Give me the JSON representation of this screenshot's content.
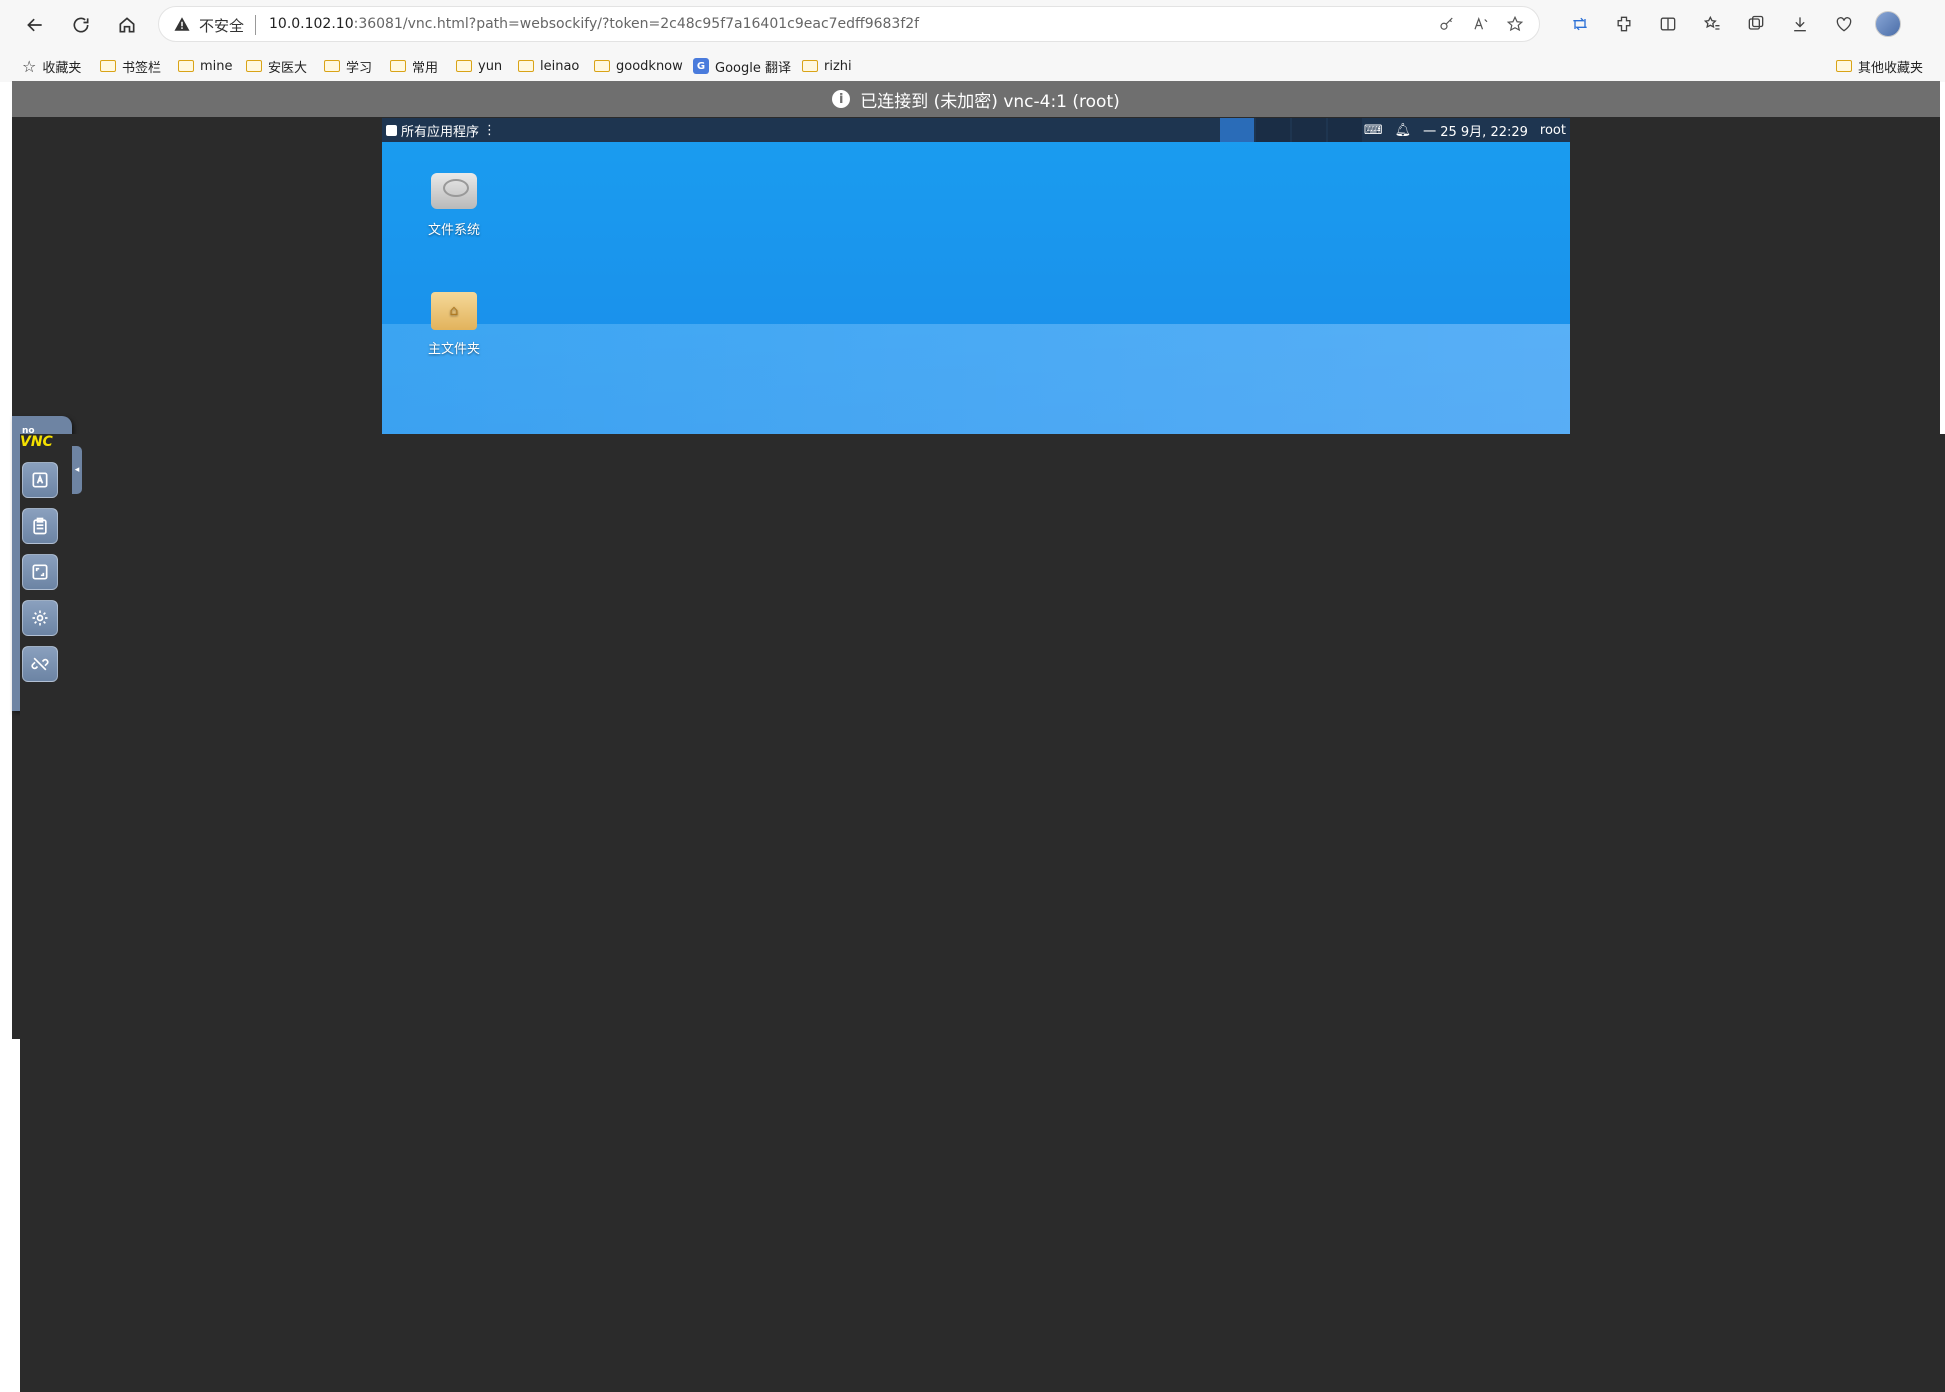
{
  "browser": {
    "insecure_label": "不安全",
    "url_host": "10.0.102.10",
    "url_rest": ":36081/vnc.html?path=websockify/?token=2c48c95f7a16401c9eac7edff9683f2f"
  },
  "bookmarks": {
    "favorites": "收藏夹",
    "items": [
      "书签栏",
      "mine",
      "安医大",
      "学习",
      "常用",
      "yun",
      "leinao",
      "goodknow",
      "Google 翻译",
      "rizhi"
    ],
    "other": "其他收藏夹"
  },
  "vnc": {
    "status": "已连接到 (未加密) vnc-4:1 (root)"
  },
  "desktop": {
    "apps_menu": "所有应用程序",
    "clock": "一 25 9月, 22:29",
    "user": "root",
    "icons": [
      {
        "label": "文件系统"
      },
      {
        "label": "主文件夹"
      }
    ]
  },
  "novnc": {
    "logo_no": "no",
    "logo_vnc": "VNC"
  }
}
